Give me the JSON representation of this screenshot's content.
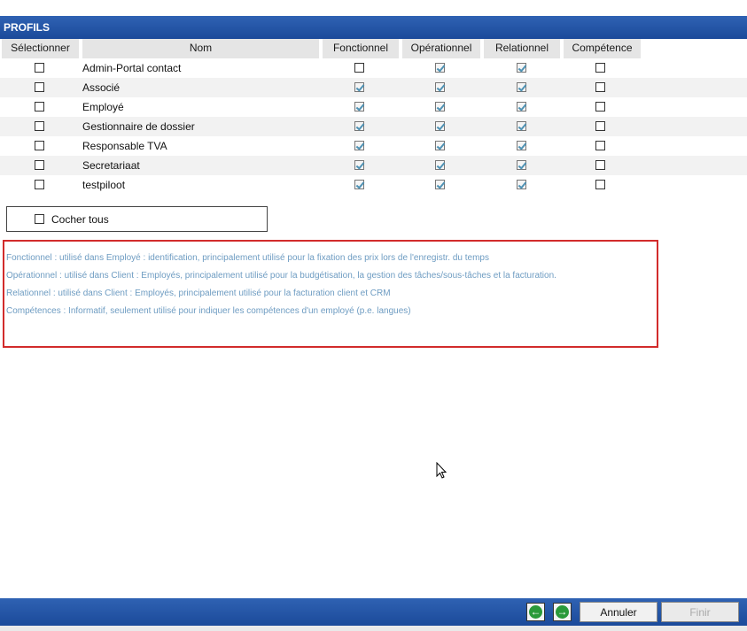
{
  "section_title": "PROFILS",
  "columns": {
    "select": "Sélectionner",
    "name": "Nom",
    "fonctionnel": "Fonctionnel",
    "operationnel": "Opérationnel",
    "relationnel": "Relationnel",
    "competence": "Compétence"
  },
  "profiles": [
    {
      "name": "Admin-Portal contact",
      "selected": false,
      "fonctionnel": false,
      "operationnel": true,
      "relationnel": true,
      "competence": false
    },
    {
      "name": "Associé",
      "selected": false,
      "fonctionnel": true,
      "operationnel": true,
      "relationnel": true,
      "competence": false
    },
    {
      "name": "Employé",
      "selected": false,
      "fonctionnel": true,
      "operationnel": true,
      "relationnel": true,
      "competence": false
    },
    {
      "name": "Gestionnaire de dossier",
      "selected": false,
      "fonctionnel": true,
      "operationnel": true,
      "relationnel": true,
      "competence": false
    },
    {
      "name": "Responsable TVA",
      "selected": false,
      "fonctionnel": true,
      "operationnel": true,
      "relationnel": true,
      "competence": false
    },
    {
      "name": "Secretariaat",
      "selected": false,
      "fonctionnel": true,
      "operationnel": true,
      "relationnel": true,
      "competence": false
    },
    {
      "name": "testpiloot",
      "selected": false,
      "fonctionnel": true,
      "operationnel": true,
      "relationnel": true,
      "competence": false
    }
  ],
  "check_all_label": "Cocher tous",
  "legend": [
    "Fonctionnel : utilisé dans Employé : identification, principalement utilisé pour la fixation des prix lors de l'enregistr. du temps",
    "Opérationnel : utilisé dans Client : Employés, principalement utilisé pour la budgétisation, la gestion des tâches/sous-tâches et la facturation.",
    "Relationnel : utilisé dans Client : Employés, principalement utilisé pour la facturation client et CRM",
    "Compétences : Informatif, seulement utilisé pour indiquer les compétences d'un employé (p.e. langues)"
  ],
  "footer": {
    "prev_icon": "arrow-left-icon",
    "next_icon": "arrow-right-icon",
    "cancel_label": "Annuler",
    "finish_label": "Finir"
  },
  "colors": {
    "header_blue": "#1b4a9a",
    "legend_text": "#6e9cc2",
    "legend_border": "#d22b2b",
    "check_color": "#4f92b4"
  }
}
